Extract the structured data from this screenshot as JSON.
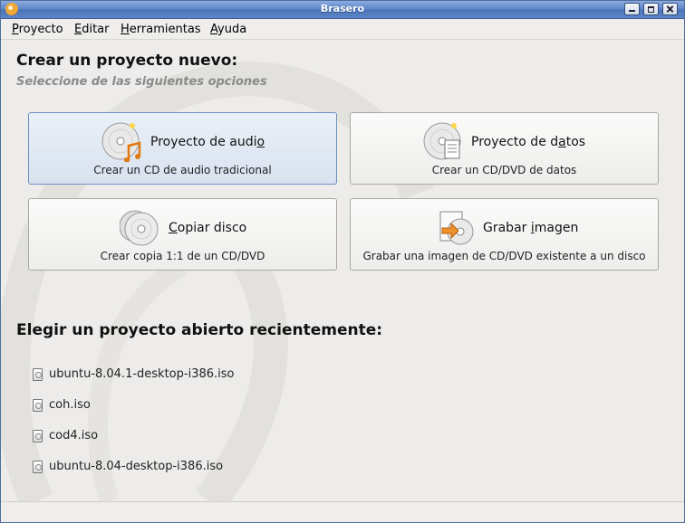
{
  "window": {
    "title": "Brasero"
  },
  "menubar": {
    "items": [
      {
        "mnemonic": "P",
        "rest": "royecto"
      },
      {
        "mnemonic": "E",
        "rest": "ditar"
      },
      {
        "mnemonic": "H",
        "rest": "erramientas"
      },
      {
        "mnemonic": "A",
        "rest": "yuda"
      }
    ]
  },
  "main": {
    "heading": "Crear un proyecto nuevo:",
    "subheading": "Seleccione de las siguientes opciones",
    "projects": [
      {
        "title_pre": "Proyecto de audi",
        "title_mn": "o",
        "title_post": "",
        "desc": "Crear un CD de audio tradicional",
        "icon": "audio-disc-icon"
      },
      {
        "title_pre": "Proyecto de d",
        "title_mn": "a",
        "title_post": "tos",
        "desc": "Crear un CD/DVD de datos",
        "icon": "data-disc-icon"
      },
      {
        "title_pre": "",
        "title_mn": "C",
        "title_post": "opiar disco",
        "desc": "Crear copia 1:1 de un CD/DVD",
        "icon": "copy-disc-icon"
      },
      {
        "title_pre": "Grabar ",
        "title_mn": "i",
        "title_post": "magen",
        "desc": "Grabar una imagen de CD/DVD existente a un disco",
        "icon": "burn-image-icon"
      }
    ],
    "recent_heading": "Elegir un proyecto abierto recientemente:",
    "recent": [
      "ubuntu-8.04.1-desktop-i386.iso",
      "coh.iso",
      "cod4.iso",
      "ubuntu-8.04-desktop-i386.iso"
    ]
  },
  "colors": {
    "titlebar": "#5b84c5",
    "accent_border": "#6d8fc0",
    "disc_highlight": "#f2a73a"
  }
}
